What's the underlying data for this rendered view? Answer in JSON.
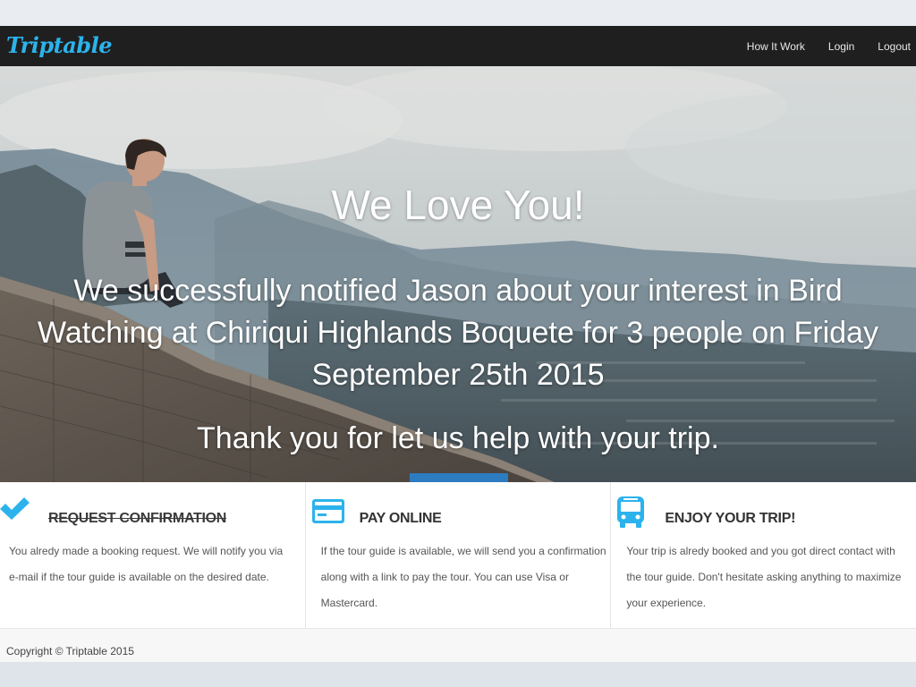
{
  "brand": {
    "name": "Triptable",
    "color": "#2cb3ec"
  },
  "nav": {
    "items": [
      {
        "label": "How It Work"
      },
      {
        "label": "Login"
      },
      {
        "label": "Logout"
      }
    ]
  },
  "hero": {
    "title": "We Love You!",
    "message_line1": "We successfully notified Jason about your interest in Bird",
    "message_line2": "Watching at Chiriqui Highlands Boquete for 3 people on Friday",
    "message_line3": "September 25th 2015",
    "thanks": "Thank you for let us help with your trip."
  },
  "features": [
    {
      "icon": "checkmark-icon",
      "title": "REQUEST CONFIRMATION",
      "completed": true,
      "text": "You alredy made a booking request. We will notify you via e-mail if the tour guide is available on the desired date."
    },
    {
      "icon": "credit-card-icon",
      "title": "PAY ONLINE",
      "completed": false,
      "text": "If the tour guide is available, we will send you a confirmation along with a link to pay the tour. You can use Visa or Mastercard."
    },
    {
      "icon": "bus-icon",
      "title": "ENJOY YOUR TRIP!",
      "completed": false,
      "text": "Your trip is alredy booked and you got direct contact with the tour guide. Don't hesitate asking anything to maximize your experience."
    }
  ],
  "footer": {
    "copyright": "Copyright © Triptable 2015"
  },
  "colors": {
    "accent": "#2cb3ec",
    "navbar": "#1f1f1f",
    "hero_tab": "#2d7cc0"
  }
}
